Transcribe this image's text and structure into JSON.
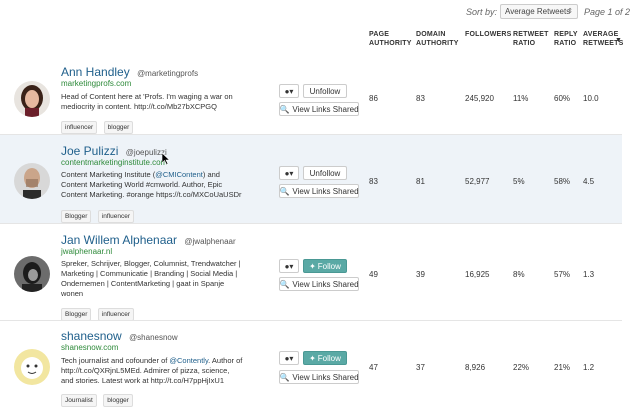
{
  "sort": {
    "label": "Sort by:",
    "selected": "Average Retweets",
    "page_info": "Page 1 of 2"
  },
  "columns": {
    "page_authority": [
      "PAGE",
      "AUTHORITY"
    ],
    "domain_authority": [
      "DOMAIN",
      "AUTHORITY"
    ],
    "followers": [
      "FOLLOWERS"
    ],
    "retweet_ratio": [
      "RETWEET",
      "RATIO"
    ],
    "reply_ratio": [
      "REPLY",
      "RATIO"
    ],
    "average_retweets": [
      "AVERAGE",
      "RETWEETS"
    ]
  },
  "buttons": {
    "unfollow": "Unfollow",
    "follow": "Follow",
    "view_links": "View Links Shared"
  },
  "users": [
    {
      "name": "Ann Handley",
      "handle": "@marketingprofs",
      "site": "marketingprofs.com",
      "bio": [
        "Head of Content here at 'Profs. I'm waging a war on",
        "mediocrity in content. http://t.co/Mb27bXCPGQ"
      ],
      "tags": [
        "influencer",
        "blogger"
      ],
      "following": true,
      "page_authority": "86",
      "domain_authority": "83",
      "followers": "245,920",
      "retweet_ratio": "11%",
      "reply_ratio": "60%",
      "average_retweets": "10.0"
    },
    {
      "name": "Joe Pulizzi",
      "handle": "@joepulizzi",
      "site": "contentmarketinginstitute.com",
      "bio_parts": [
        "Content Marketing Institute (",
        "@CMIContent",
        ") and"
      ],
      "bio": [
        "Content Marketing World #cmworld. Author, Epic",
        "Content Marketing. #orange https://t.co/MXCoUaUSDr"
      ],
      "tags": [
        "Blogger",
        "influencer"
      ],
      "following": true,
      "page_authority": "83",
      "domain_authority": "81",
      "followers": "52,977",
      "retweet_ratio": "5%",
      "reply_ratio": "58%",
      "average_retweets": "4.5"
    },
    {
      "name": "Jan Willem Alphenaar",
      "handle": "@jwalphenaar",
      "site": "jwalphenaar.nl",
      "bio": [
        "Spreker, Schrijver, Blogger, Columnist, Trendwatcher |",
        "Marketing | Communicatie | Branding | Social Media |",
        "Ondernemen | ContentMarketing | gaat in Spanje",
        "wonen"
      ],
      "tags": [
        "Blogger",
        "influencer"
      ],
      "following": false,
      "page_authority": "49",
      "domain_authority": "39",
      "followers": "16,925",
      "retweet_ratio": "8%",
      "reply_ratio": "57%",
      "average_retweets": "1.3"
    },
    {
      "name": "shanesnow",
      "handle": "@shanesnow",
      "site": "shanesnow.com",
      "bio_parts": [
        "Tech journalist and cofounder of ",
        "@Contently",
        ". Author of"
      ],
      "bio": [
        "http://t.co/QXRjnL5MEd. Admirer of pizza, science,",
        "and stories. Latest work at http://t.co/H7ppHjIxU1"
      ],
      "tags": [
        "Journalist",
        "blogger"
      ],
      "following": false,
      "page_authority": "47",
      "domain_authority": "37",
      "followers": "8,926",
      "retweet_ratio": "22%",
      "reply_ratio": "21%",
      "average_retweets": "1.2"
    }
  ]
}
